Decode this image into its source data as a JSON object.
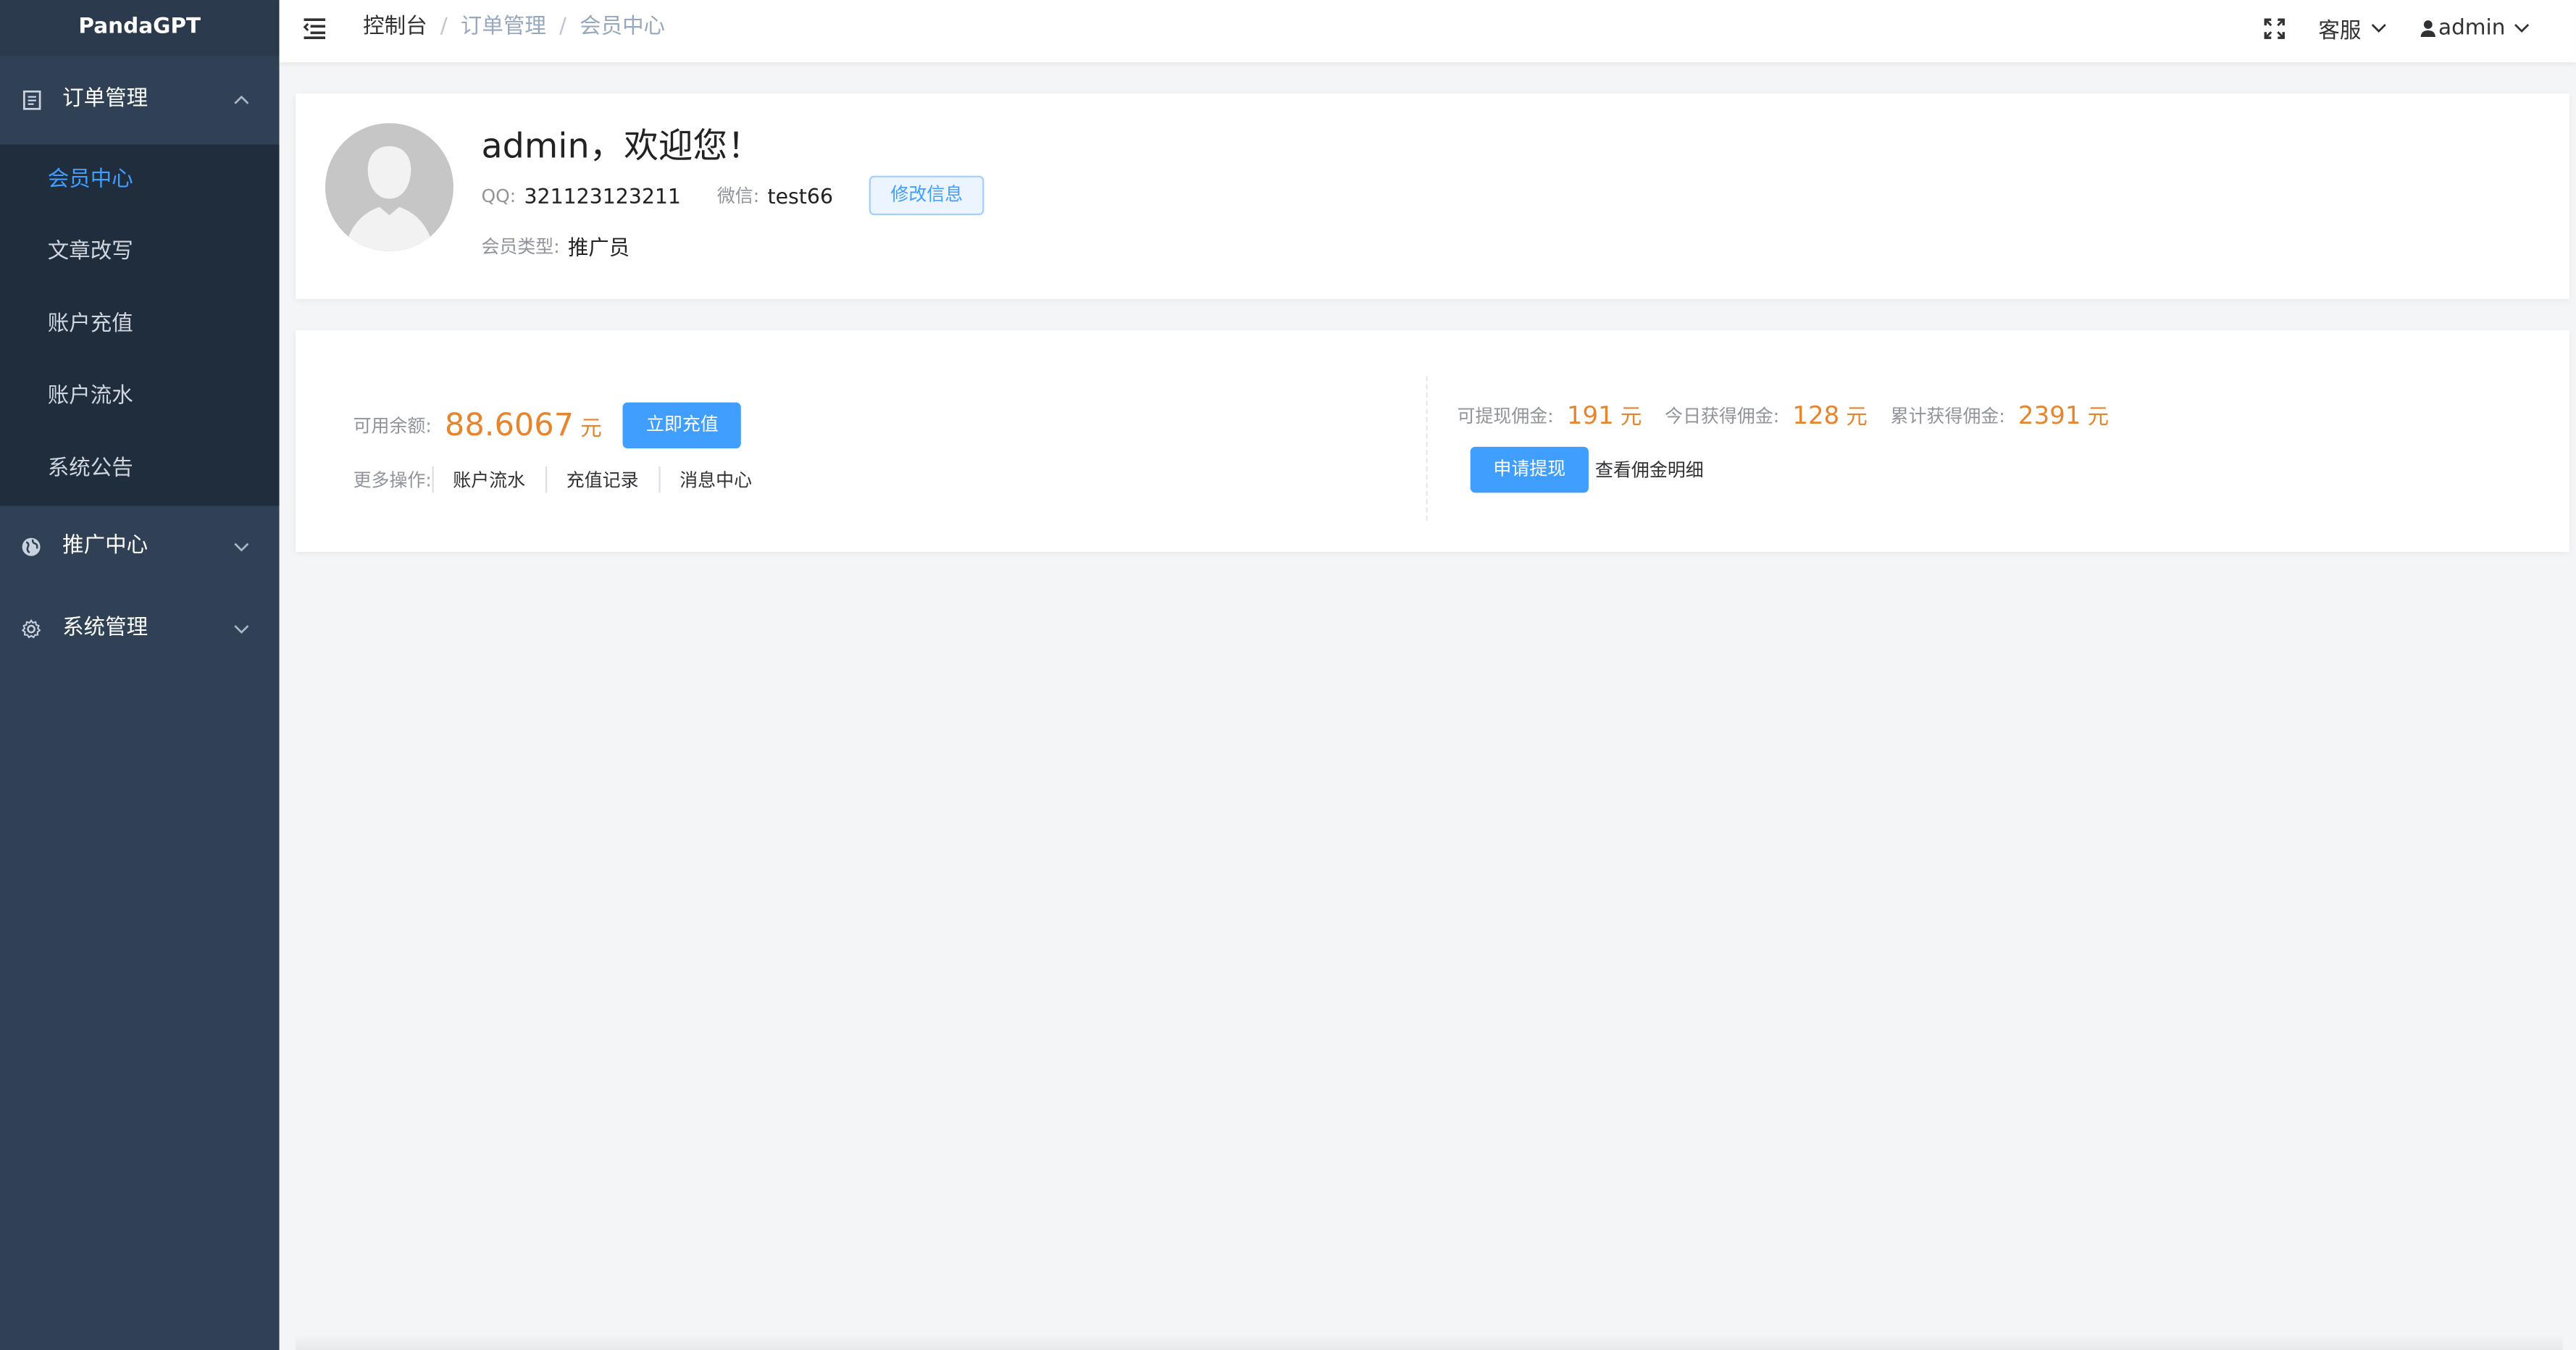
{
  "sidebar": {
    "brand": "PandaGPT",
    "groups": [
      {
        "label": "订单管理",
        "icon": "document-icon",
        "expanded": true,
        "items": [
          {
            "label": "会员中心",
            "active": true
          },
          {
            "label": "文章改写",
            "active": false
          },
          {
            "label": "账户充值",
            "active": false
          },
          {
            "label": "账户流水",
            "active": false
          },
          {
            "label": "系统公告",
            "active": false
          }
        ]
      },
      {
        "label": "推广中心",
        "icon": "globe-icon",
        "expanded": false
      },
      {
        "label": "系统管理",
        "icon": "gear-icon",
        "expanded": false
      }
    ]
  },
  "navbar": {
    "breadcrumb": [
      "控制台",
      "订单管理",
      "会员中心"
    ],
    "service_label": "客服",
    "user_label": "admin",
    "icons": {
      "hamburger": "hamburger-icon",
      "fullscreen": "fullscreen-icon",
      "user": "user-icon"
    }
  },
  "profile": {
    "welcome": "admin，欢迎您！",
    "qq_label": "QQ:",
    "qq_value": "321123123211",
    "wechat_label": "微信:",
    "wechat_value": "test66",
    "edit_button": "修改信息",
    "member_type_label": "会员类型:",
    "member_type_value": "推广员"
  },
  "wallet": {
    "balance_label": "可用余额:",
    "balance_value": "88.6067",
    "balance_unit": "元",
    "recharge_button": "立即充值",
    "more_label": "更多操作:",
    "more_links": [
      "账户流水",
      "充值记录",
      "消息中心"
    ],
    "withdrawable_label": "可提现佣金:",
    "withdrawable_value": "191",
    "today_label": "今日获得佣金:",
    "today_value": "128",
    "total_label": "累计获得佣金:",
    "total_value": "2391",
    "unit": "元",
    "withdraw_button": "申请提现",
    "detail_link": "查看佣金明细"
  },
  "colors": {
    "sidebar_bg": "#304156",
    "submenu_bg": "#1f2d3d",
    "accent": "#409eff",
    "amount": "#e6852e"
  }
}
